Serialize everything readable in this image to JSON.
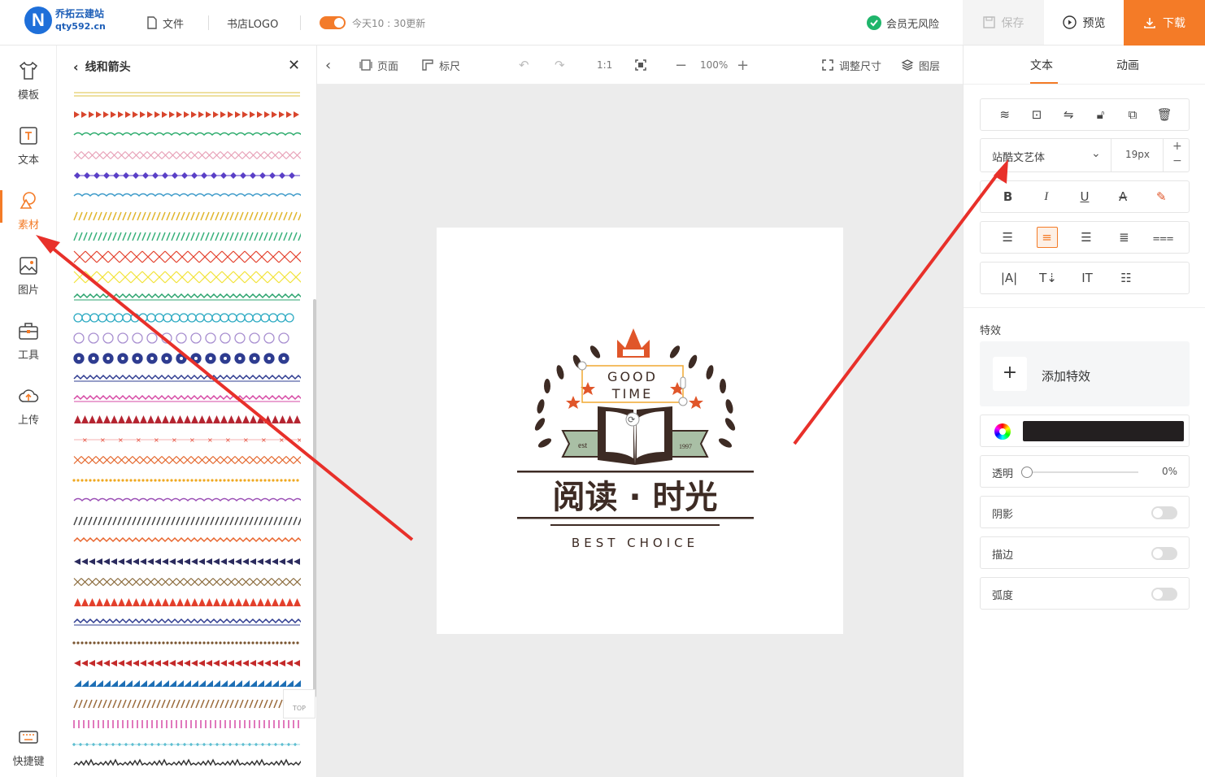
{
  "brand": {
    "name": "乔拓云建站",
    "url": "qty592.cn",
    "mark": "N"
  },
  "topbar": {
    "file_label": "文件",
    "doc_title": "书店LOGO",
    "autosave_text": "今天10 : 30更新",
    "member_text": "会员无风险",
    "save_label": "保存",
    "preview_label": "预览",
    "download_label": "下载"
  },
  "leftnav": {
    "items": [
      {
        "label": "模板",
        "icon": "shirt-icon"
      },
      {
        "label": "文本",
        "icon": "text-icon"
      },
      {
        "label": "素材",
        "icon": "material-icon"
      },
      {
        "label": "图片",
        "icon": "image-icon"
      },
      {
        "label": "工具",
        "icon": "toolbox-icon"
      },
      {
        "label": "上传",
        "icon": "cloud-upload-icon"
      }
    ],
    "shortcut_label": "快捷键"
  },
  "panel": {
    "title": "线和箭头",
    "top_label": "TOP",
    "rows": [
      {
        "style": "double-line",
        "color": "#e8d580"
      },
      {
        "style": "triangles",
        "color": "#d8452c"
      },
      {
        "style": "wave",
        "color": "#2bab6b"
      },
      {
        "style": "cross",
        "color": "#e8a3b8"
      },
      {
        "style": "diamond-dots",
        "color": "#5a3fc7"
      },
      {
        "style": "wave",
        "color": "#3c9ac9"
      },
      {
        "style": "slashes",
        "color": "#e0b52b"
      },
      {
        "style": "slashes",
        "color": "#37b07a"
      },
      {
        "style": "big-cross",
        "color": "#e3402c"
      },
      {
        "style": "big-cross",
        "color": "#f2e236"
      },
      {
        "style": "zigzag",
        "color": "#2aa36d"
      },
      {
        "style": "circles",
        "color": "#2aa9c2"
      },
      {
        "style": "rings",
        "color": "#a88fd0"
      },
      {
        "style": "dotrings",
        "color": "#2e3c90"
      },
      {
        "style": "zigzag",
        "color": "#2e3c90"
      },
      {
        "style": "braid",
        "color": "#d64aa5"
      },
      {
        "style": "solid-triangles",
        "color": "#b52531"
      },
      {
        "style": "dot-line",
        "color": "#e3402c"
      },
      {
        "style": "lattice",
        "color": "#e3662c"
      },
      {
        "style": "dotted",
        "color": "#f0a820"
      },
      {
        "style": "wave",
        "color": "#9b4fb5"
      },
      {
        "style": "slashes",
        "color": "#444444"
      },
      {
        "style": "chevrons",
        "color": "#e8642c"
      },
      {
        "style": "arrows",
        "color": "#2b2b5e"
      },
      {
        "style": "cross",
        "color": "#8a6a3b"
      },
      {
        "style": "solid-triangles",
        "color": "#e3402c"
      },
      {
        "style": "zigzag",
        "color": "#2e3c90"
      },
      {
        "style": "dotted",
        "color": "#7a5530"
      },
      {
        "style": "arrows",
        "color": "#c42a2a"
      },
      {
        "style": "saw",
        "color": "#1e6fb5"
      },
      {
        "style": "slashes",
        "color": "#9a6a3b"
      },
      {
        "style": "ticks",
        "color": "#d64aa5"
      },
      {
        "style": "plus",
        "color": "#2aa9c2"
      },
      {
        "style": "rough",
        "color": "#333333"
      }
    ]
  },
  "canvas_toolbar": {
    "page_label": "页面",
    "ruler_label": "标尺",
    "ratio_label": "1:1",
    "zoom": "100%",
    "resize_label": "调整尺寸",
    "layers_label": "图层"
  },
  "logo_art": {
    "good": "GOOD",
    "time": "TIME",
    "est": "est",
    "year": "1997",
    "headline": "阅读 · 时光",
    "tagline": "BEST CHOICE",
    "colors": {
      "dark": "#3d2b24",
      "orange": "#e0562a",
      "ribbon": "#a9bfa5"
    }
  },
  "rightpanel": {
    "tab_text": "文本",
    "tab_anim": "动画",
    "font_name": "站酷文艺体",
    "font_size": "19px",
    "effects_title": "特效",
    "add_effect": "添加特效",
    "text_color": "#231f20",
    "opacity_label": "透明",
    "opacity_value": "0%",
    "shadow_label": "阴影",
    "stroke_label": "描边",
    "curve_label": "弧度"
  },
  "accent": "#f47b27"
}
